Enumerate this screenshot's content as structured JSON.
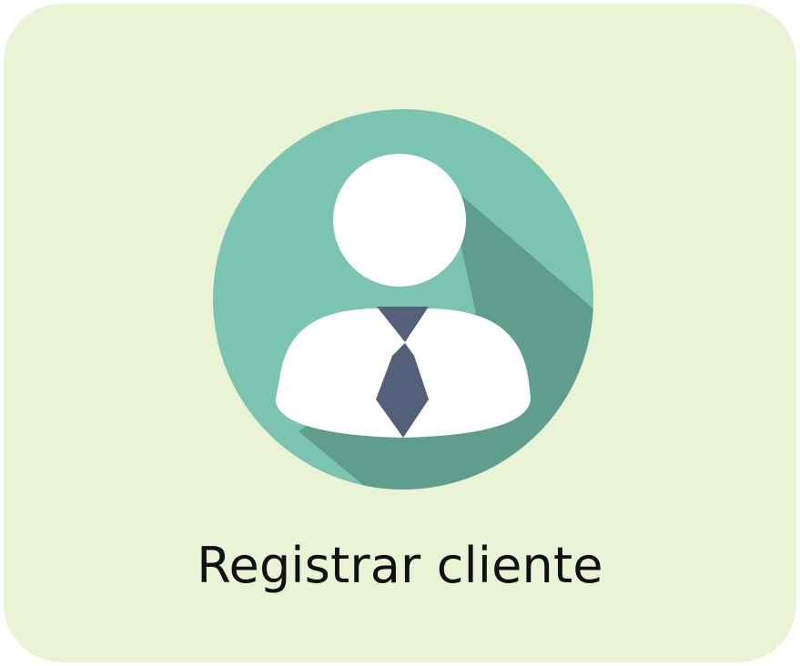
{
  "tile": {
    "label": "Registrar cliente",
    "icon": "user-with-tie-icon"
  },
  "colors": {
    "tile_background": "#EAF3D6",
    "circle": "#7BC4AF",
    "shadow": "#5F9E8C",
    "person": "#FFFFFF",
    "tie": "#526079",
    "text": "#111111"
  }
}
